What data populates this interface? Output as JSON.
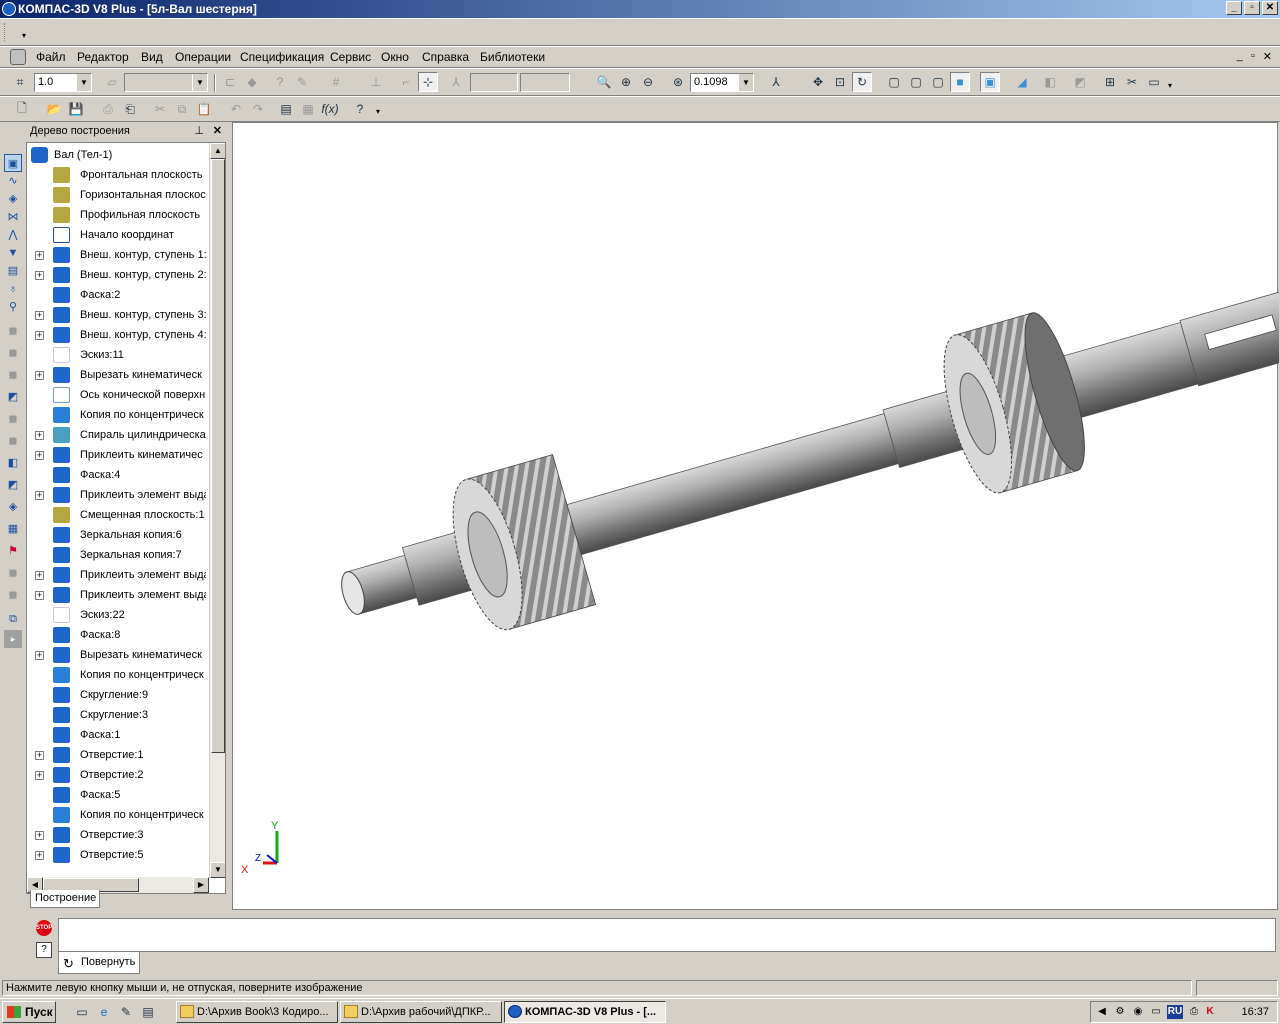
{
  "window": {
    "title": "КОМПАС-3D V8 Plus - [5л-Вал шестерня]"
  },
  "menu": [
    "Файл",
    "Редактор",
    "Вид",
    "Операции",
    "Спецификация",
    "Сервис",
    "Окно",
    "Справка",
    "Библиотеки"
  ],
  "toolbar": {
    "step_value": "1.0",
    "zoom_value": "0.1098"
  },
  "tree": {
    "title": "Дерево построения",
    "root": "Вал (Тел-1)",
    "items": [
      {
        "label": "Фронтальная плоскость",
        "icon": "plane-icon",
        "exp": false
      },
      {
        "label": "Горизонтальная плоскос",
        "icon": "plane-icon",
        "exp": false
      },
      {
        "label": "Профильная плоскость",
        "icon": "plane-icon",
        "exp": false
      },
      {
        "label": "Начало координат",
        "icon": "origin-icon",
        "exp": false
      },
      {
        "label": "Внеш. контур, ступень 1:",
        "icon": "extrude-icon",
        "exp": true
      },
      {
        "label": "Внеш. контур, ступень 2:",
        "icon": "extrude-icon",
        "exp": true
      },
      {
        "label": "Фаска:2",
        "icon": "chamfer-icon",
        "exp": false
      },
      {
        "label": "Внеш. контур, ступень 3:",
        "icon": "extrude-icon",
        "exp": true
      },
      {
        "label": "Внеш. контур, ступень 4:",
        "icon": "extrude-icon",
        "exp": true
      },
      {
        "label": "Эскиз:11",
        "icon": "sketch-icon",
        "exp": false
      },
      {
        "label": "Вырезать кинематическ",
        "icon": "sweep-cut-icon",
        "exp": true
      },
      {
        "label": "Ось конической поверхн",
        "icon": "axis-icon",
        "exp": false
      },
      {
        "label": "Копия по концентрическ",
        "icon": "pattern-icon",
        "exp": false
      },
      {
        "label": "Спираль цилиндрическа",
        "icon": "helix-icon",
        "exp": true
      },
      {
        "label": "Приклеить кинематичес",
        "icon": "sweep-icon",
        "exp": true
      },
      {
        "label": "Фаска:4",
        "icon": "chamfer-icon",
        "exp": false
      },
      {
        "label": "Приклеить элемент выда",
        "icon": "extrude-icon",
        "exp": true
      },
      {
        "label": "Смещенная плоскость:1",
        "icon": "plane-icon",
        "exp": false
      },
      {
        "label": "Зеркальная копия:6",
        "icon": "mirror-icon",
        "exp": false
      },
      {
        "label": "Зеркальная копия:7",
        "icon": "mirror-icon",
        "exp": false
      },
      {
        "label": "Приклеить элемент выда",
        "icon": "extrude-icon",
        "exp": true
      },
      {
        "label": "Приклеить элемент выда",
        "icon": "extrude-icon",
        "exp": true
      },
      {
        "label": "Эскиз:22",
        "icon": "sketch-icon",
        "exp": false
      },
      {
        "label": "Фаска:8",
        "icon": "chamfer-icon",
        "exp": false
      },
      {
        "label": "Вырезать кинематическ",
        "icon": "sweep-cut-icon",
        "exp": true
      },
      {
        "label": "Копия по концентрическ",
        "icon": "pattern-icon",
        "exp": false
      },
      {
        "label": "Скругление:9",
        "icon": "fillet-icon",
        "exp": false
      },
      {
        "label": "Скругление:3",
        "icon": "fillet-icon",
        "exp": false
      },
      {
        "label": "Фаска:1",
        "icon": "chamfer-icon",
        "exp": false
      },
      {
        "label": "Отверстие:1",
        "icon": "hole-icon",
        "exp": true
      },
      {
        "label": "Отверстие:2",
        "icon": "hole-icon",
        "exp": true
      },
      {
        "label": "Фаска:5",
        "icon": "chamfer-icon",
        "exp": false
      },
      {
        "label": "Копия по концентрическ",
        "icon": "pattern-icon",
        "exp": false
      },
      {
        "label": "Отверстие:3",
        "icon": "hole-icon",
        "exp": true
      },
      {
        "label": "Отверстие:5",
        "icon": "hole-icon",
        "exp": true
      }
    ],
    "tab": "Построение"
  },
  "axes": {
    "x": "X",
    "y": "Y",
    "z": "Z"
  },
  "bottom": {
    "rotate_tab": "Повернуть"
  },
  "status": {
    "text": "Нажмите левую кнопку мыши и, не отпуская, поверните изображение"
  },
  "taskbar": {
    "start": "Пуск",
    "tasks": [
      "D:\\Архив Book\\3 Кодиро...",
      "D:\\Архив рабочий\\ДПКР...",
      "КОМПАС-3D V8 Plus - [..."
    ],
    "lang": "RU",
    "clock": "16:37"
  }
}
